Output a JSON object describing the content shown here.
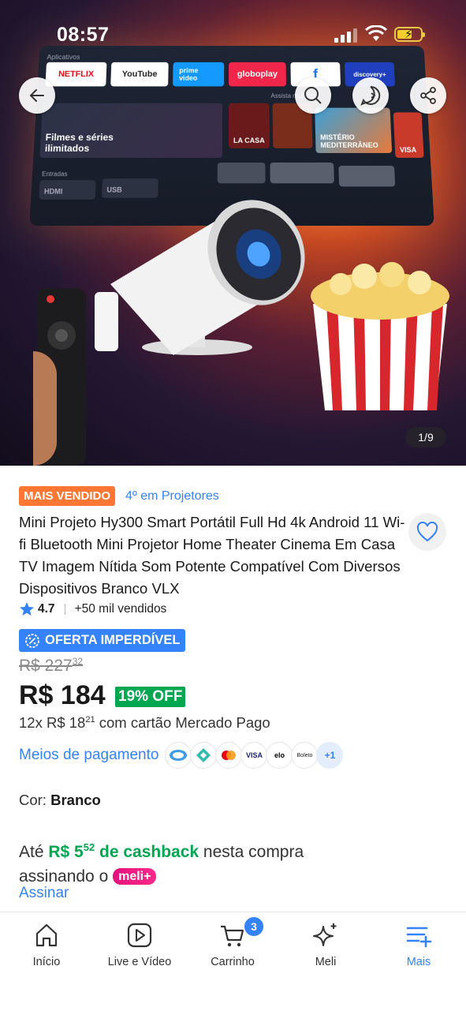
{
  "status_bar": {
    "time": "08:57"
  },
  "gallery": {
    "counter": "1/9",
    "screen": {
      "apps_label": "Aplicativos",
      "apps": [
        {
          "name": "NETFLIX",
          "color": "#ffffff",
          "text_color": "#e50914"
        },
        {
          "name": "YouTube",
          "color": "#ffffff",
          "text_color": "#222222"
        },
        {
          "name": "prime video",
          "color": "#1399ff",
          "text_color": "#ffffff"
        },
        {
          "name": "globoplay",
          "color": "#f0264a",
          "text_color": "#ffffff"
        },
        {
          "name": "f",
          "color": "#ffffff",
          "text_color": "#1877f2"
        },
        {
          "name": "discovery+",
          "color": "#1f3fbf",
          "text_color": "#ffffff"
        }
      ],
      "continue_label": "Assista no Pedlix",
      "card_main": "Filmes e séries ilimitados",
      "card_1": "LA CASA",
      "card_2": "MISTÉRIO MEDITERRÂNEO",
      "card_3": "VISA",
      "inputs_label": "Entradas",
      "input_1": "HDMI",
      "input_2": "USB"
    }
  },
  "product": {
    "badge": "MAIS VENDIDO",
    "rank": "4º em Projetores",
    "title": "Mini Projeto Hy300 Smart Portátil Full Hd 4k Android 11 Wi-fi Bluetooth Mini Projetor Home Theater Cinema Em Casa TV Imagem Nítida Som Potente Compatível Com Diversos Dispositivos Branco VLX",
    "rating": "4.7",
    "sold": "+50 mil vendidos",
    "offer_label": "OFERTA IMPERDÍVEL",
    "old_price_main": "R$ 227",
    "old_price_cents": "32",
    "price": "R$ 184",
    "discount": "19% OFF",
    "installment_prefix": "12x R$ 18",
    "installment_cents": "21",
    "installment_suffix": " com cartão Mercado Pago",
    "payment_link": "Meios de pagamento",
    "payment_icons": [
      "mercado-pago-icon",
      "pix-icon",
      "mastercard-icon",
      "VISA",
      "elo",
      "Boleto",
      "+1"
    ],
    "color_label": "Cor: ",
    "color_value": "Branco",
    "cashback_prefix": "Até ",
    "cashback_amount": "R$ 5",
    "cashback_cents": "52",
    "cashback_mid": " de cashback",
    "cashback_suffix": " nesta compra assinando o ",
    "meli_plus": "meli+",
    "subscribe": "Assinar"
  },
  "nav": {
    "items": [
      {
        "label": "Início"
      },
      {
        "label": "Live e Vídeo"
      },
      {
        "label": "Carrinho",
        "badge": "3"
      },
      {
        "label": "Meli"
      },
      {
        "label": "Mais"
      }
    ]
  },
  "colors": {
    "accent": "#3483fa",
    "green": "#00a650",
    "orange": "#ff7733"
  }
}
